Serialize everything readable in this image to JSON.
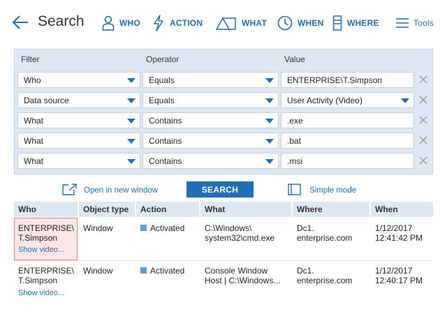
{
  "header": {
    "title": "Search",
    "nav": [
      {
        "label": "WHO",
        "icon": "person-icon"
      },
      {
        "label": "ACTION",
        "icon": "lightning-icon"
      },
      {
        "label": "WHAT",
        "icon": "shapes-icon"
      },
      {
        "label": "WHEN",
        "icon": "clock-icon"
      },
      {
        "label": "WHERE",
        "icon": "server-icon"
      }
    ],
    "tools_label": "Tools"
  },
  "filters": {
    "columns": [
      "Filter",
      "Operator",
      "Value"
    ],
    "rows": [
      {
        "filter": "Who",
        "operator": "Equals",
        "value": "ENTERPRISE\\T.Simpson",
        "value_dropdown": false
      },
      {
        "filter": "Data source",
        "operator": "Equals",
        "value": "User Activity (Video)",
        "value_dropdown": true
      },
      {
        "filter": "What",
        "operator": "Contains",
        "value": ".exe",
        "value_dropdown": false
      },
      {
        "filter": "What",
        "operator": "Contains",
        "value": ".bat",
        "value_dropdown": false
      },
      {
        "filter": "What",
        "operator": "Contains",
        "value": ".msi",
        "value_dropdown": false
      }
    ]
  },
  "actions": {
    "open_new_window": "Open in new window",
    "search": "SEARCH",
    "simple_mode": "Simple mode"
  },
  "results": {
    "columns": [
      "Who",
      "Object type",
      "Action",
      "What",
      "Where",
      "When"
    ],
    "rows": [
      {
        "who_line1": "ENTERPRISE\\",
        "who_line2": "T.Simpson",
        "show_video": "Show video...",
        "object_type": "Window",
        "action": "Activated",
        "what_line1": "C:\\Windows\\",
        "what_line2": "system32\\cmd.exe",
        "where_line1": "Dc1.",
        "where_line2": "enterprise.com",
        "when_line1": "1/12/2017",
        "when_line2": "12:41:42 PM"
      },
      {
        "who_line1": "ENTERPRISE\\",
        "who_line2": "T.Simpson",
        "show_video": "Show video...",
        "object_type": "Window",
        "action": "Activated",
        "what_line1": "Console Window",
        "what_line2": "Host | C:\\Windows...",
        "where_line1": "Dc1.",
        "where_line2": "enterprise.com",
        "when_line1": "1/12/2017",
        "when_line2": "12:40:17 PM"
      }
    ]
  },
  "colors": {
    "accent": "#1e6fb8",
    "panel_bg": "#dde8f3",
    "highlight_bg": "#fce6e6",
    "highlight_border": "#e48c8c",
    "action_marker": "#5a9fd4"
  }
}
